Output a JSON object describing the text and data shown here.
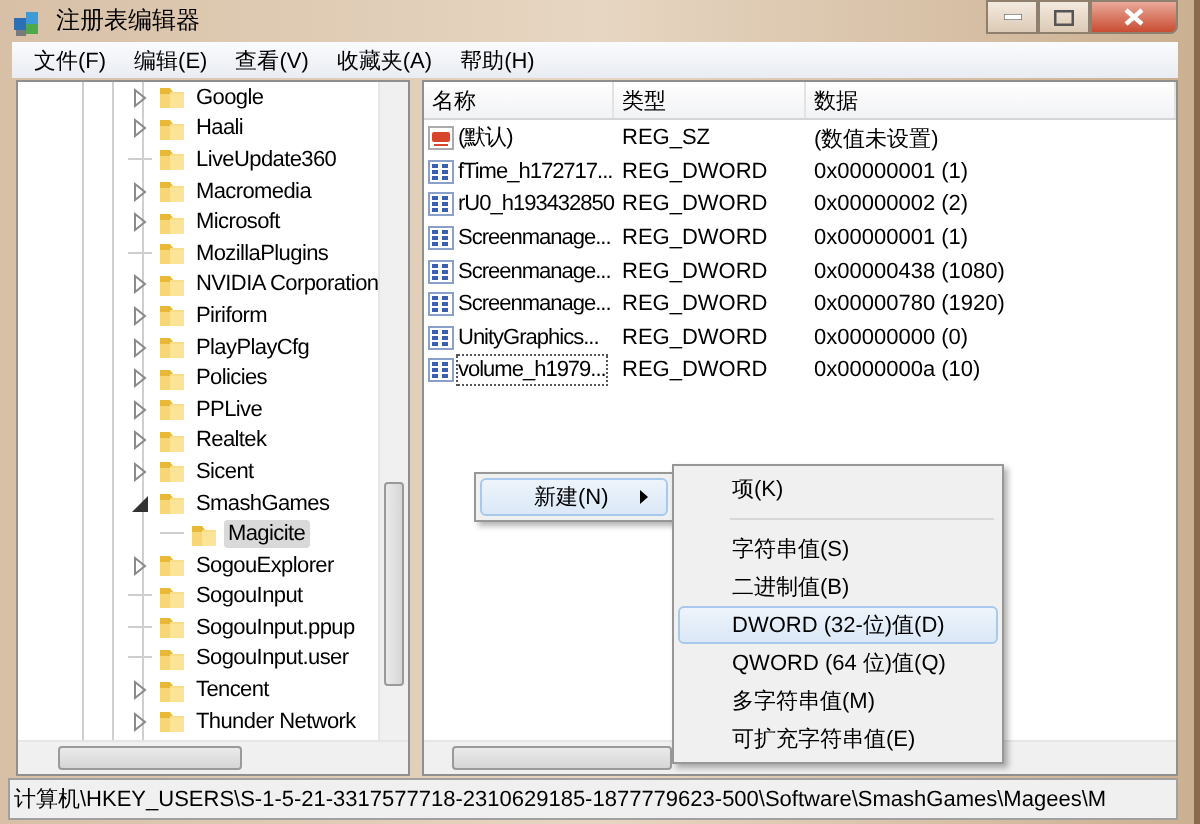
{
  "window": {
    "title": "注册表编辑器"
  },
  "menu_bar": [
    "文件(F)",
    "编辑(E)",
    "查看(V)",
    "收藏夹(A)",
    "帮助(H)"
  ],
  "tree": {
    "items": [
      {
        "label": "Google",
        "has_children": true,
        "expanded": false,
        "selected": false
      },
      {
        "label": "Haali",
        "has_children": true,
        "expanded": false,
        "selected": false
      },
      {
        "label": "LiveUpdate360",
        "has_children": false,
        "expanded": false,
        "selected": false
      },
      {
        "label": "Macromedia",
        "has_children": true,
        "expanded": false,
        "selected": false
      },
      {
        "label": "Microsoft",
        "has_children": true,
        "expanded": false,
        "selected": false
      },
      {
        "label": "MozillaPlugins",
        "has_children": false,
        "expanded": false,
        "selected": false
      },
      {
        "label": "NVIDIA Corporation",
        "has_children": true,
        "expanded": false,
        "selected": false
      },
      {
        "label": "Piriform",
        "has_children": true,
        "expanded": false,
        "selected": false
      },
      {
        "label": "PlayPlayCfg",
        "has_children": true,
        "expanded": false,
        "selected": false
      },
      {
        "label": "Policies",
        "has_children": true,
        "expanded": false,
        "selected": false
      },
      {
        "label": "PPLive",
        "has_children": true,
        "expanded": false,
        "selected": false
      },
      {
        "label": "Realtek",
        "has_children": true,
        "expanded": false,
        "selected": false
      },
      {
        "label": "Sicent",
        "has_children": true,
        "expanded": false,
        "selected": false
      },
      {
        "label": "SmashGames",
        "has_children": true,
        "expanded": true,
        "selected": false,
        "children": [
          {
            "label": "Magicite",
            "has_children": false,
            "expanded": false,
            "selected": true
          }
        ]
      },
      {
        "label": "SogouExplorer",
        "has_children": true,
        "expanded": false,
        "selected": false
      },
      {
        "label": "SogouInput",
        "has_children": false,
        "expanded": false,
        "selected": false
      },
      {
        "label": "SogouInput.ppup",
        "has_children": false,
        "expanded": false,
        "selected": false
      },
      {
        "label": "SogouInput.user",
        "has_children": false,
        "expanded": false,
        "selected": false
      },
      {
        "label": "Tencent",
        "has_children": true,
        "expanded": false,
        "selected": false
      },
      {
        "label": "Thunder Network",
        "has_children": true,
        "expanded": false,
        "selected": false
      }
    ]
  },
  "values": {
    "columns": [
      "名称",
      "类型",
      "数据"
    ],
    "rows": [
      {
        "kind": "string",
        "name": "(默认)",
        "type": "REG_SZ",
        "data": "(数值未设置)",
        "focused": false
      },
      {
        "kind": "dword",
        "name": "fTime_h172717...",
        "type": "REG_DWORD",
        "data": "0x00000001 (1)",
        "focused": false
      },
      {
        "kind": "dword",
        "name": "rU0_h193432850",
        "type": "REG_DWORD",
        "data": "0x00000002 (2)",
        "focused": false
      },
      {
        "kind": "dword",
        "name": "Screenmanage...",
        "type": "REG_DWORD",
        "data": "0x00000001 (1)",
        "focused": false
      },
      {
        "kind": "dword",
        "name": "Screenmanage...",
        "type": "REG_DWORD",
        "data": "0x00000438 (1080)",
        "focused": false
      },
      {
        "kind": "dword",
        "name": "Screenmanage...",
        "type": "REG_DWORD",
        "data": "0x00000780 (1920)",
        "focused": false
      },
      {
        "kind": "dword",
        "name": "UnityGraphics...",
        "type": "REG_DWORD",
        "data": "0x00000000 (0)",
        "focused": false
      },
      {
        "kind": "dword",
        "name": "volume_h1979...",
        "type": "REG_DWORD",
        "data": "0x0000000a (10)",
        "focused": true
      }
    ]
  },
  "context_menu": {
    "items": [
      {
        "label": "新建(N)",
        "selected": true,
        "has_submenu": true
      }
    ]
  },
  "submenu": {
    "items": [
      {
        "kind": "item",
        "label": "项(K)",
        "selected": false
      },
      {
        "kind": "separator"
      },
      {
        "kind": "item",
        "label": "字符串值(S)",
        "selected": false
      },
      {
        "kind": "item",
        "label": "二进制值(B)",
        "selected": false
      },
      {
        "kind": "item",
        "label": "DWORD (32-位)值(D)",
        "selected": true
      },
      {
        "kind": "item",
        "label": "QWORD (64 位)值(Q)",
        "selected": false
      },
      {
        "kind": "item",
        "label": "多字符串值(M)",
        "selected": false
      },
      {
        "kind": "item",
        "label": "可扩充字符串值(E)",
        "selected": false
      }
    ]
  },
  "status_bar": {
    "path": "计算机\\HKEY_USERS\\S-1-5-21-3317577718-2310629185-1877779623-500\\Software\\SmashGames\\Magees\\M"
  }
}
